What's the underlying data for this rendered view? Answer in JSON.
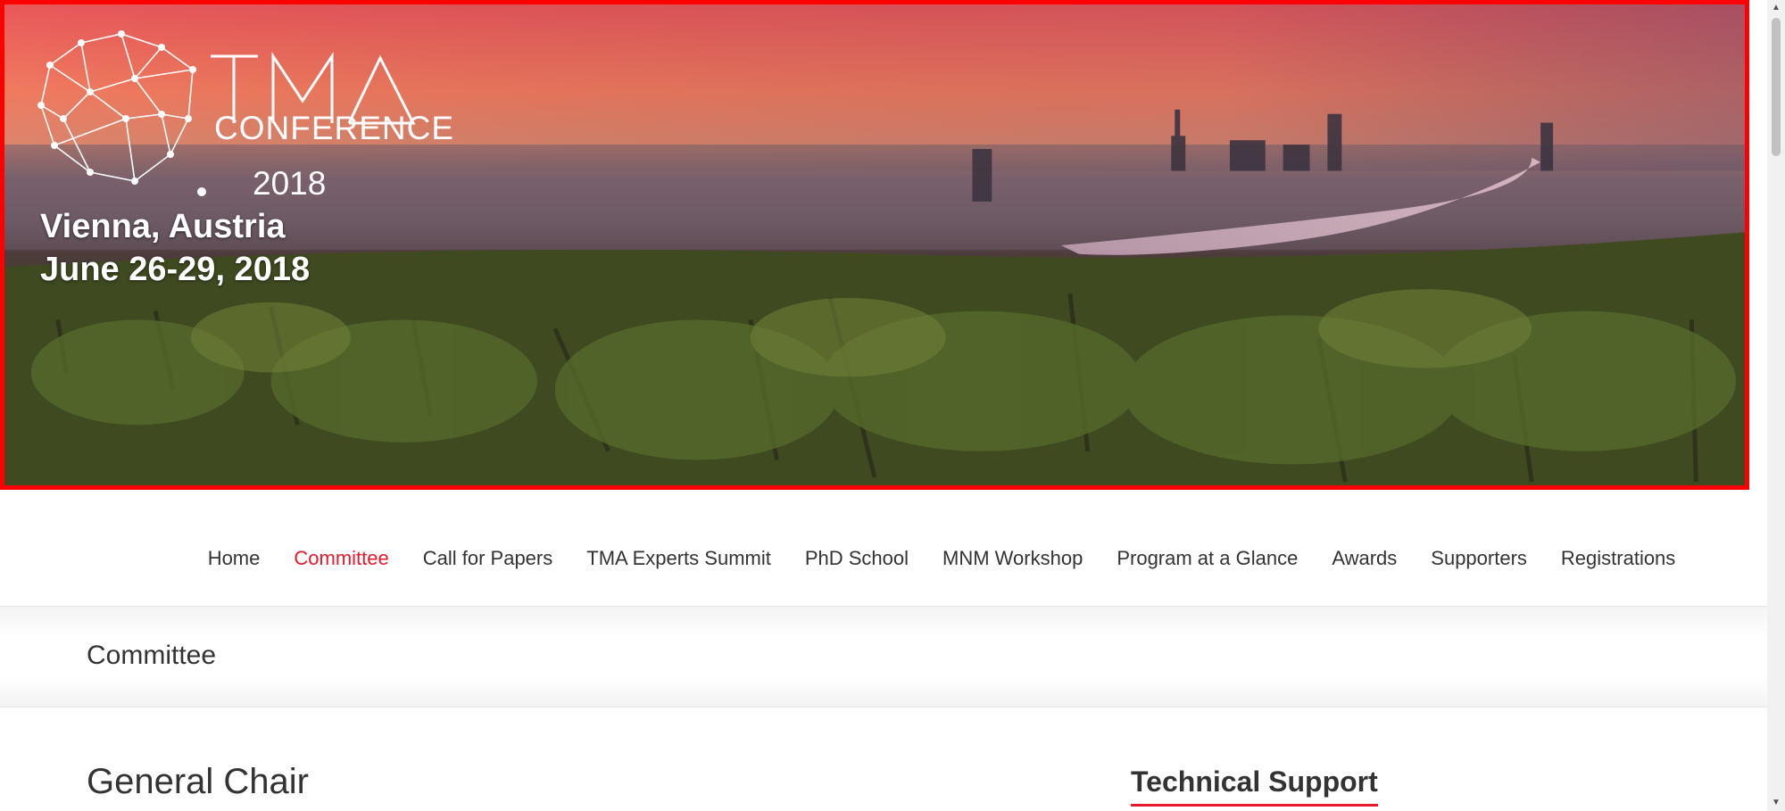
{
  "banner": {
    "logo_word": "CONFERENCE",
    "logo_year": "2018",
    "logo_letters": "TMA",
    "location": "Vienna, Austria",
    "dates": "June 26-29, 2018",
    "border_color": "#ff0000"
  },
  "nav": {
    "items": [
      {
        "label": "Home"
      },
      {
        "label": "Committee"
      },
      {
        "label": "Call for Papers"
      },
      {
        "label": "TMA Experts Summit"
      },
      {
        "label": "PhD School"
      },
      {
        "label": "MNM Workshop"
      },
      {
        "label": "Program at a Glance"
      },
      {
        "label": "Awards"
      },
      {
        "label": "Supporters"
      },
      {
        "label": "Registrations"
      }
    ],
    "active": "Committee",
    "active_color": "#e8192c"
  },
  "page": {
    "title": "Committee"
  },
  "main": {
    "section_heading": "General Chair"
  },
  "sidebar": {
    "heading": "Technical Support",
    "accent_color": "#e8192c"
  },
  "icons": {
    "scroll_up": "scroll-up-arrow-icon",
    "scroll_down": "scroll-down-arrow-icon"
  }
}
